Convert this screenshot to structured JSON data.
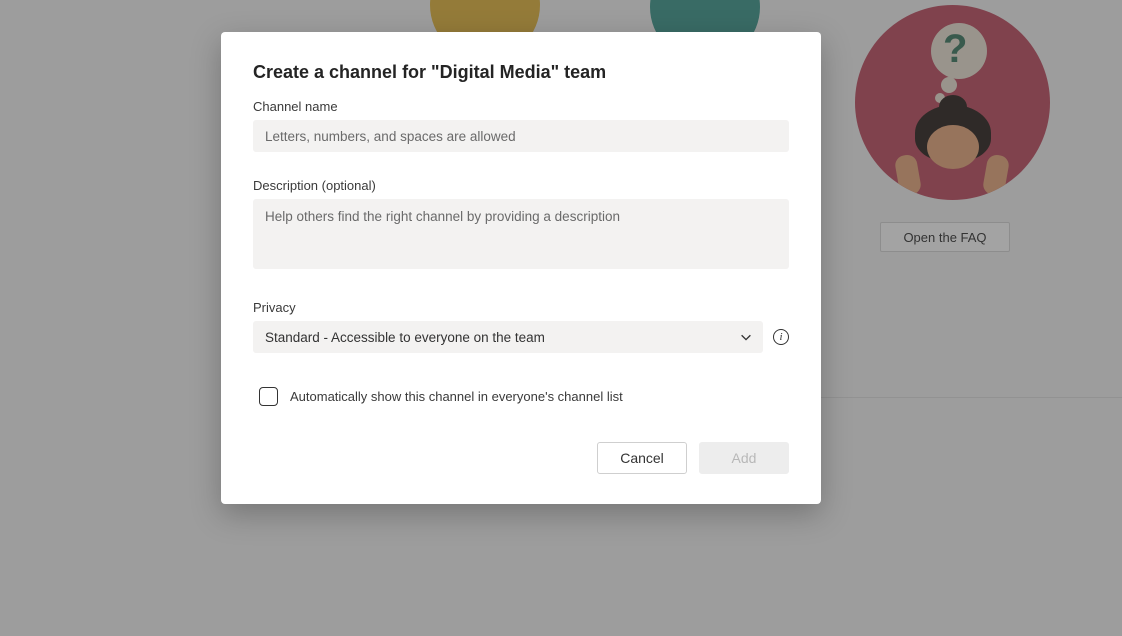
{
  "background": {
    "faq_button_label": "Open the FAQ"
  },
  "dialog": {
    "title": "Create a channel for \"Digital Media\" team",
    "channel_name": {
      "label": "Channel name",
      "placeholder": "Letters, numbers, and spaces are allowed",
      "value": ""
    },
    "description": {
      "label": "Description (optional)",
      "placeholder": "Help others find the right channel by providing a description",
      "value": ""
    },
    "privacy": {
      "label": "Privacy",
      "selected": "Standard - Accessible to everyone on the team"
    },
    "auto_show_checkbox": {
      "checked": false,
      "label": "Automatically show this channel in everyone's channel list"
    },
    "buttons": {
      "cancel": "Cancel",
      "add": "Add"
    }
  }
}
